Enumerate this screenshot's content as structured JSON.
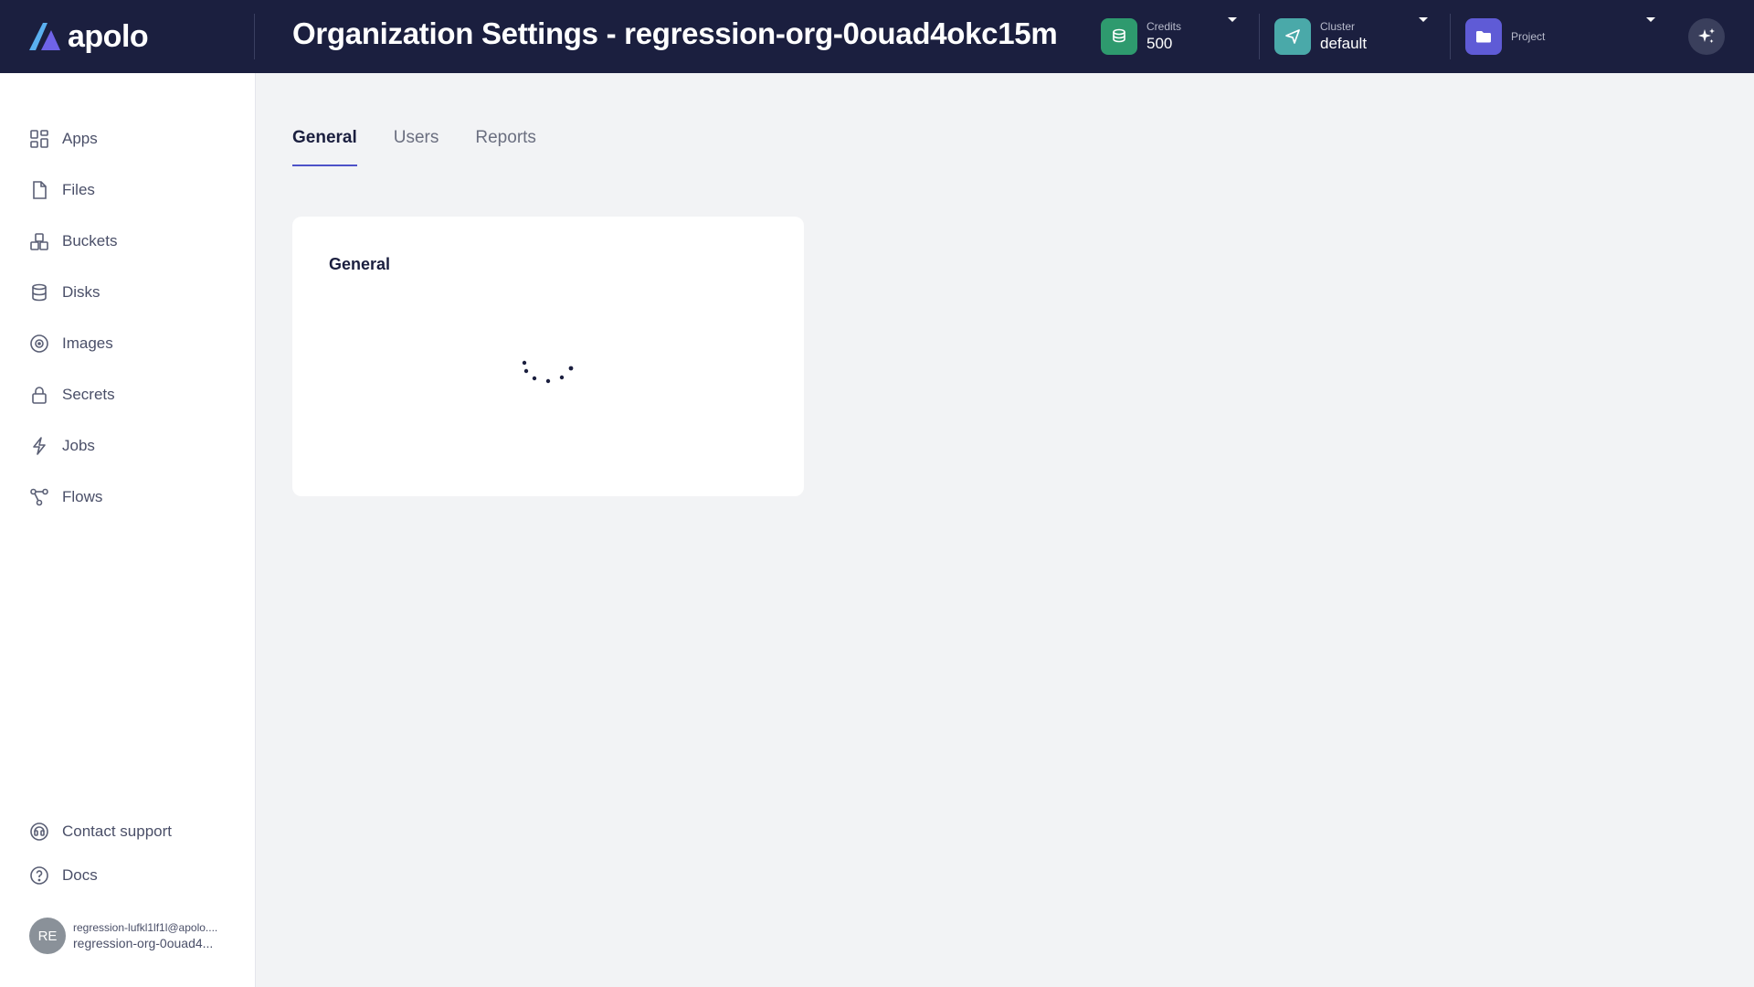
{
  "brand": {
    "name": "apolo"
  },
  "header": {
    "title": "Organization Settings - regression-org-0ouad4okc15m",
    "credits": {
      "caption": "Credits",
      "value": "500",
      "color": "#2e9a6e"
    },
    "cluster": {
      "caption": "Cluster",
      "value": "default",
      "color": "#4aa9a9"
    },
    "project": {
      "caption": "Project",
      "value": "",
      "color": "#5f5bd6"
    }
  },
  "sidebar": {
    "items": [
      {
        "label": "Apps",
        "icon": "apps-icon"
      },
      {
        "label": "Files",
        "icon": "file-icon"
      },
      {
        "label": "Buckets",
        "icon": "buckets-icon"
      },
      {
        "label": "Disks",
        "icon": "database-icon"
      },
      {
        "label": "Images",
        "icon": "image-icon"
      },
      {
        "label": "Secrets",
        "icon": "lock-icon"
      },
      {
        "label": "Jobs",
        "icon": "lightning-icon"
      },
      {
        "label": "Flows",
        "icon": "flows-icon"
      }
    ],
    "footer": [
      {
        "label": "Contact support",
        "icon": "headset-icon"
      },
      {
        "label": "Docs",
        "icon": "help-icon"
      }
    ],
    "user": {
      "initials": "RE",
      "email": "regression-lufkl1lf1l@apolo....",
      "org": "regression-org-0ouad4..."
    }
  },
  "tabs": [
    {
      "label": "General",
      "active": true
    },
    {
      "label": "Users",
      "active": false
    },
    {
      "label": "Reports",
      "active": false
    }
  ],
  "card": {
    "title": "General"
  },
  "colors": {
    "accent": "#4d52c8",
    "topbar": "#1b1f3f"
  }
}
